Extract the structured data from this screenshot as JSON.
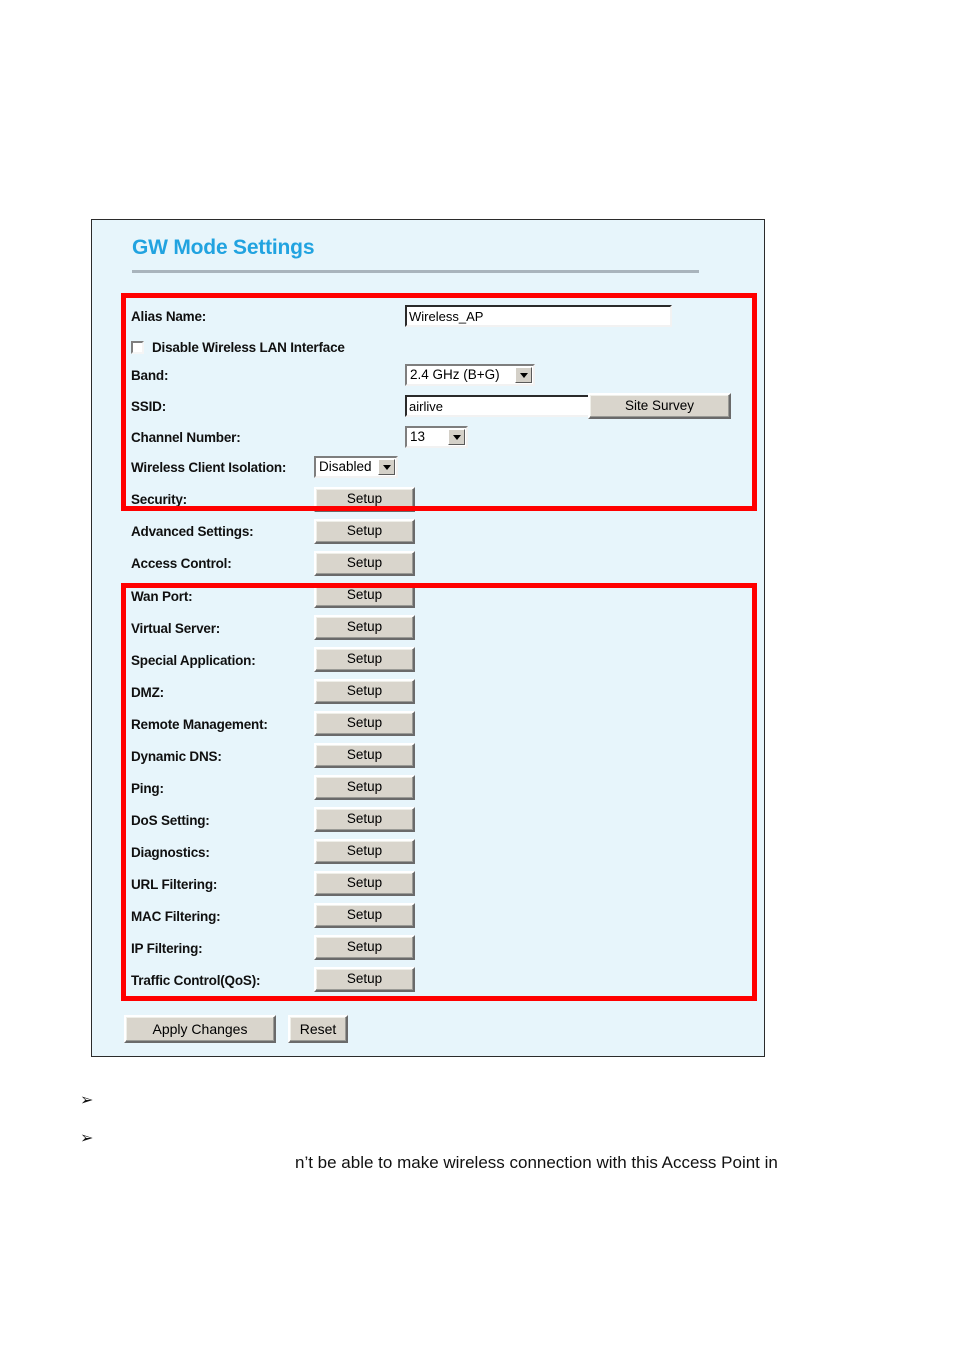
{
  "page": {
    "background_color": "#ffffff"
  },
  "panel": {
    "title": "GW Mode Settings",
    "title_color": "#21a3e0",
    "background_color": "#e7f5fb",
    "border_color": "#2b2b2b",
    "highlight_color": "#ff0000"
  },
  "wireless_section": {
    "alias_name": {
      "label": "Alias Name:",
      "value": "Wireless_AP"
    },
    "disable_wlan": {
      "label": "Disable Wireless LAN Interface",
      "checked": false
    },
    "band": {
      "label": "Band:",
      "value": "2.4 GHz (B+G)"
    },
    "ssid": {
      "label": "SSID:",
      "value": "airlive",
      "site_survey_label": "Site Survey"
    },
    "channel_number": {
      "label": "Channel Number:",
      "value": "13"
    },
    "client_isolation": {
      "label": "Wireless Client Isolation:",
      "value": "Disabled"
    },
    "setup_rows": [
      {
        "label": "Security:",
        "button": "Setup"
      },
      {
        "label": "Advanced Settings:",
        "button": "Setup"
      },
      {
        "label": "Access Control:",
        "button": "Setup"
      }
    ]
  },
  "gateway_section": {
    "setup_rows": [
      {
        "label": "Wan Port:",
        "button": "Setup"
      },
      {
        "label": "Virtual Server:",
        "button": "Setup"
      },
      {
        "label": "Special Application:",
        "button": "Setup"
      },
      {
        "label": "DMZ:",
        "button": "Setup"
      },
      {
        "label": "Remote Management:",
        "button": "Setup"
      },
      {
        "label": "Dynamic DNS:",
        "button": "Setup"
      },
      {
        "label": "Ping:",
        "button": "Setup"
      },
      {
        "label": "DoS Setting:",
        "button": "Setup"
      },
      {
        "label": "Diagnostics:",
        "button": "Setup"
      },
      {
        "label": "URL Filtering:",
        "button": "Setup"
      },
      {
        "label": "MAC Filtering:",
        "button": "Setup"
      },
      {
        "label": "IP Filtering:",
        "button": "Setup"
      },
      {
        "label": "Traffic Control(QoS):",
        "button": "Setup"
      }
    ]
  },
  "footer_buttons": {
    "apply_label": "Apply Changes",
    "reset_label": "Reset"
  },
  "document_body": {
    "bullet_marker": "➢",
    "bullet_1_text": "",
    "bullet_2_text": "",
    "line_1": "n’t be able to make wireless connection with this Access Point in"
  }
}
